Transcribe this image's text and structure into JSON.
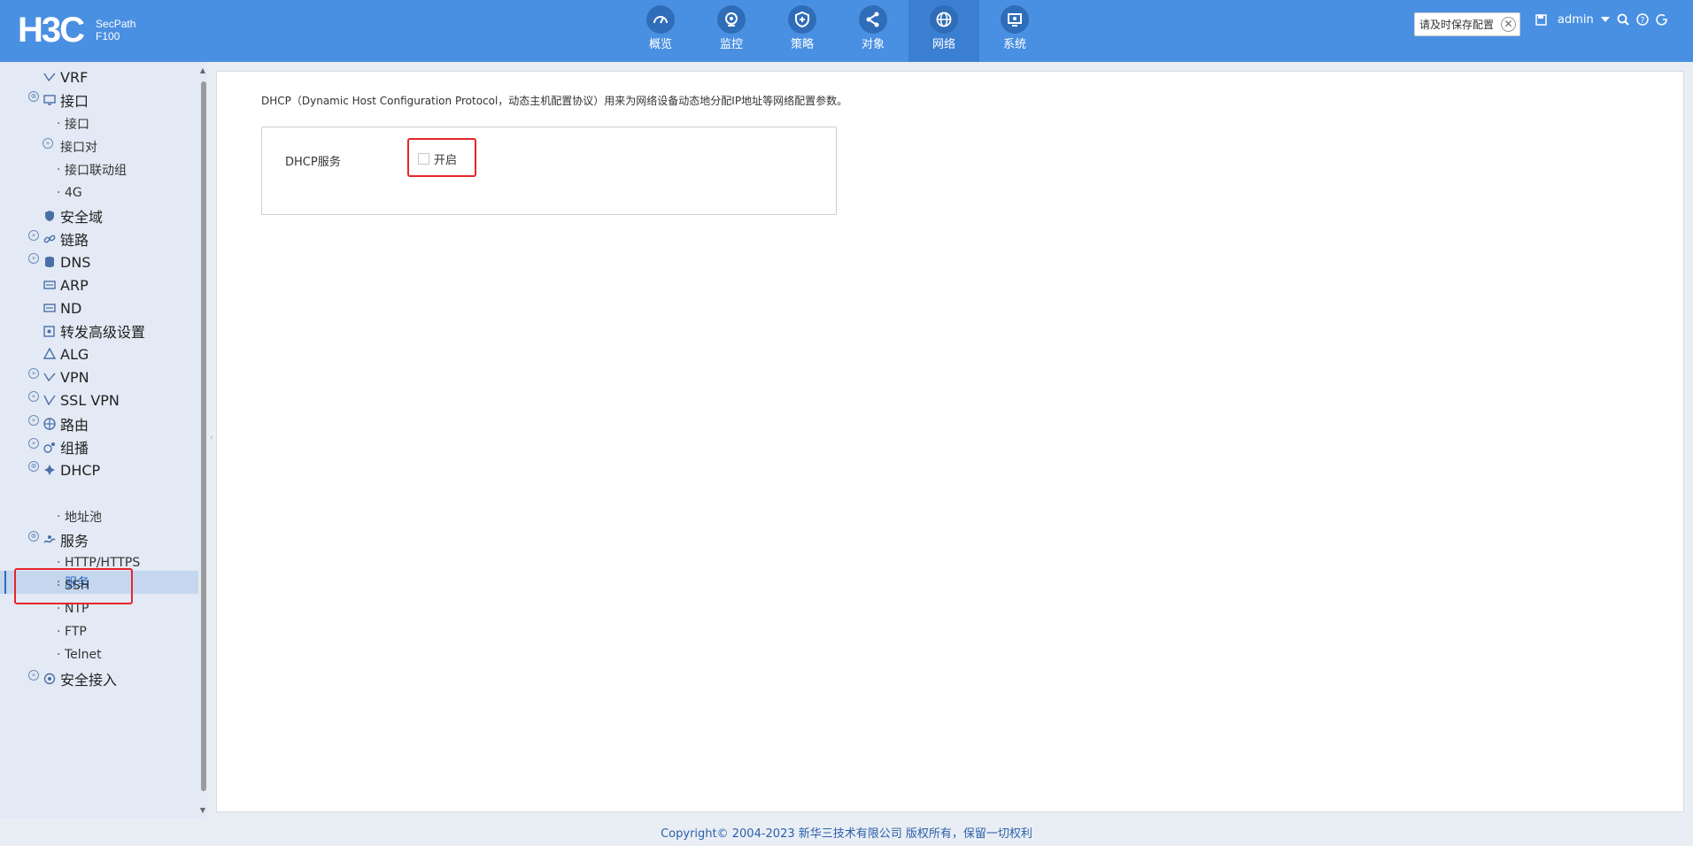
{
  "header": {
    "logo_text": "H3C",
    "product_line1": "SecPath",
    "product_line2": "F100",
    "nav": [
      {
        "label": "概览",
        "icon": "gauge-icon"
      },
      {
        "label": "监控",
        "icon": "camera-icon"
      },
      {
        "label": "策略",
        "icon": "shield-icon"
      },
      {
        "label": "对象",
        "icon": "share-icon"
      },
      {
        "label": "网络",
        "icon": "globe-icon",
        "active": true
      },
      {
        "label": "系统",
        "icon": "monitor-icon"
      }
    ],
    "save_tip": "请及时保存配置",
    "save_tip_close": "✕",
    "username": "admin",
    "colors": {
      "header_bg": "#4a90e2",
      "active_nav": "#3b7fd2"
    }
  },
  "sidebar": {
    "items": [
      {
        "label": "VRF"
      },
      {
        "label": "接口"
      },
      {
        "label": "接口"
      },
      {
        "label": "接口对"
      },
      {
        "label": "接口联动组"
      },
      {
        "label": "4G"
      },
      {
        "label": "安全域"
      },
      {
        "label": "链路"
      },
      {
        "label": "DNS"
      },
      {
        "label": "ARP"
      },
      {
        "label": "ND"
      },
      {
        "label": "转发高级设置"
      },
      {
        "label": "ALG"
      },
      {
        "label": "VPN"
      },
      {
        "label": "SSL VPN"
      },
      {
        "label": "路由"
      },
      {
        "label": "组播"
      },
      {
        "label": "DHCP"
      },
      {
        "label": "服务"
      },
      {
        "label": "地址池"
      },
      {
        "label": "服务"
      },
      {
        "label": "HTTP/HTTPS"
      },
      {
        "label": "SSH"
      },
      {
        "label": "NTP"
      },
      {
        "label": "FTP"
      },
      {
        "label": "Telnet"
      },
      {
        "label": "安全接入"
      }
    ]
  },
  "main": {
    "description": "DHCP（Dynamic Host Configuration Protocol，动态主机配置协议）用来为网络设备动态地分配IP地址等网络配置参数。",
    "dhcp_service_label": "DHCP服务",
    "enable_label": "开启",
    "enable_checked": false
  },
  "footer": {
    "copyright": "Copyright© 2004-2023 新华三技术有限公司 版权所有，保留一切权利"
  }
}
